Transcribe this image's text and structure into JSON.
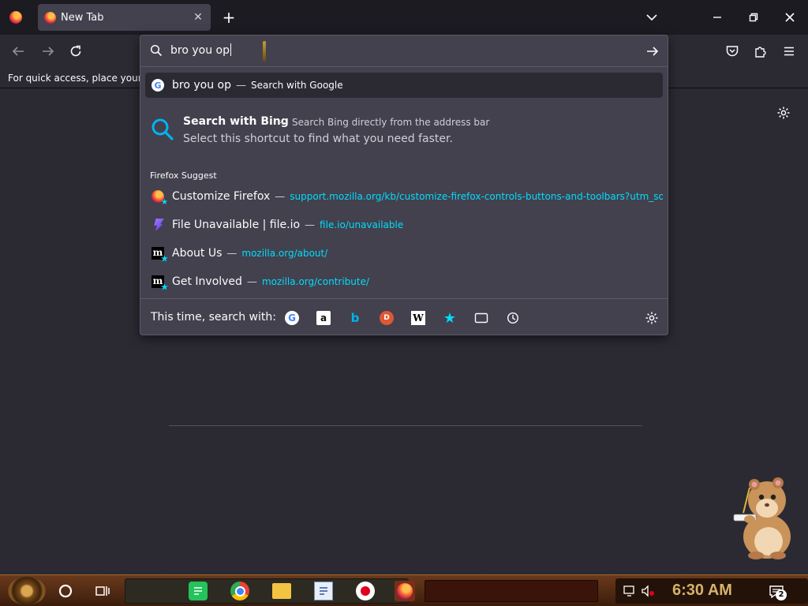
{
  "tabs": [
    {
      "title": "New Tab"
    }
  ],
  "toolbar": {
    "bookmarks_hint": "For quick access, place your bookmarks here on the bookmarks toolbar."
  },
  "urlbar": {
    "input_value": "bro you op",
    "rows": {
      "google": {
        "title": "bro you op",
        "sep": "—",
        "action": "Search with Google",
        "icon": "google-icon"
      },
      "bing_tip": {
        "title": "Search with Bing",
        "sep": "—",
        "subtitle": "Search Bing directly from the address bar",
        "description": "Select this shortcut to find what you need faster.",
        "icon": "search-icon"
      }
    },
    "suggest_heading": "Firefox Suggest",
    "suggestions": [
      {
        "title": "Customize Firefox",
        "sep": "—",
        "url": "support.mozilla.org/kb/customize-firefox-controls-buttons-and-toolbars?utm_source",
        "icon": "firefox-icon"
      },
      {
        "title": "File Unavailable | file.io",
        "sep": "—",
        "url": "file.io/unavailable",
        "icon": "fileio-icon"
      },
      {
        "title": "About Us",
        "sep": "—",
        "url": "mozilla.org/about/",
        "icon": "mozilla-icon"
      },
      {
        "title": "Get Involved",
        "sep": "—",
        "url": "mozilla.org/contribute/",
        "icon": "mozilla-icon"
      }
    ],
    "oneoff_label": "This time, search with:",
    "oneoff_engines": [
      {
        "name": "google",
        "glyph": "G"
      },
      {
        "name": "amazon",
        "glyph": "a"
      },
      {
        "name": "bing",
        "glyph": "b"
      },
      {
        "name": "duckduckgo",
        "glyph": "D"
      },
      {
        "name": "wikipedia",
        "glyph": "W"
      }
    ]
  },
  "taskbar": {
    "clock": "6:30 AM",
    "notification_count": "2"
  },
  "colors": {
    "accent_cyan": "#00ddff",
    "bing_blue": "#00b3f4",
    "panel": "#42414d",
    "toolbar": "#2b2a33",
    "clock_gold": "#d7b26a"
  }
}
